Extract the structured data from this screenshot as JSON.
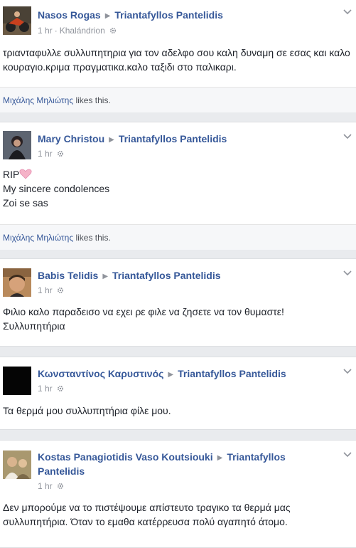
{
  "posts": [
    {
      "author": "Nasos Rogas",
      "target": "Triantafyllos Pantelidis",
      "time": "1 hr",
      "location": "Khalándrion",
      "text": "τριανταφυλλε συλλυπητηρια για τον αδελφο σου καλη δυναμη σε εσας και καλο κουραγιο.κριμα πραγματικα.καλο ταξιδι στο παλικαρι.",
      "likes_name": "Μιχάλης Μηλιώτης",
      "likes_suffix": " likes this."
    },
    {
      "author": "Mary Christou",
      "target": "Triantafyllos Pantelidis",
      "time": "1 hr",
      "line1": "RIP",
      "line2": "My sincere condolences",
      "line3": "Zoi se sas",
      "likes_name": "Μιχάλης Μηλιώτης",
      "likes_suffix": " likes this."
    },
    {
      "author": "Babis Telidis",
      "target": "Triantafyllos Pantelidis",
      "time": "1 hr",
      "line1": "Φιλιο καλο παραδεισο να εχει ρε φιλε να ζησετε να τον θυμαστε!",
      "line2": "Συλλυπητήρια"
    },
    {
      "author": "Κωνσταντίνος Καρυστινός",
      "target": "Triantafyllos Pantelidis",
      "time": "1 hr",
      "text": "Τα θερμά μου συλλυπητήρια φίλε μου."
    },
    {
      "author": "Kostas Panagiotidis Vaso Koutsiouki",
      "target": "Triantafyllos",
      "target2": "Pantelidis",
      "time": "1 hr",
      "line1": "Δεν μπορούμε να το πιστέψουμε απίστευτο τραγικο τα θερμά μας",
      "line2": "συλλυπητήρια. Όταν το εμαθα κατέρρευσα πολύ αγαπητό άτομο."
    }
  ],
  "separator": "·",
  "icons": {
    "arrow": "▶",
    "audience": "gear-icon",
    "menu": "chevron-down-icon",
    "heart": "heart-icon"
  },
  "colors": {
    "link": "#365899",
    "meta": "#90949c",
    "heart": "#f5b3c8"
  }
}
